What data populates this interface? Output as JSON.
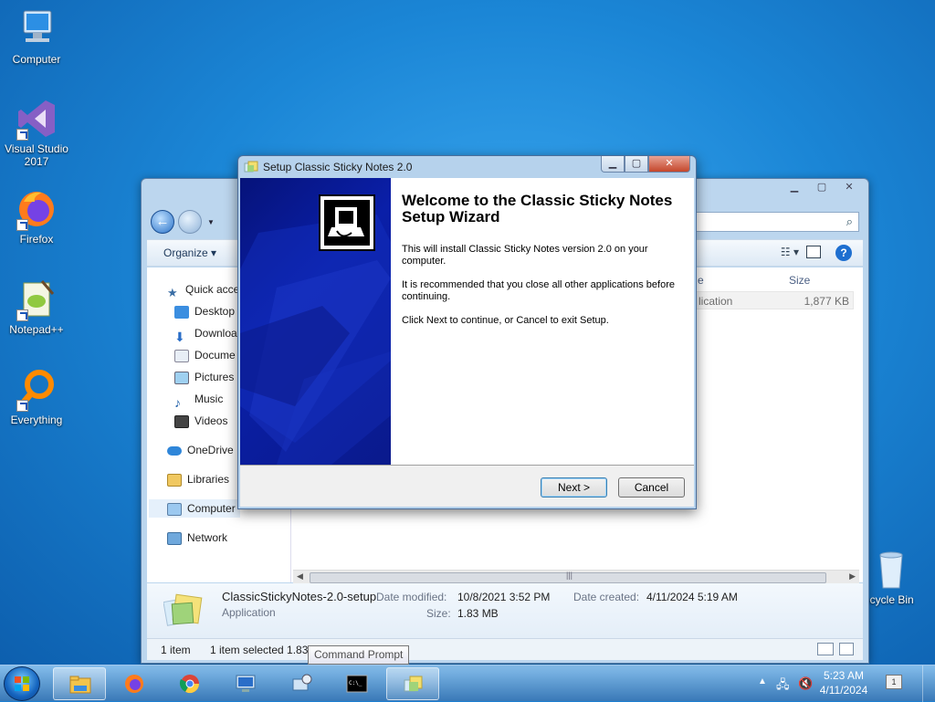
{
  "desktop_icons": [
    {
      "label": "Computer",
      "icon": "computer-icon"
    },
    {
      "label": "Visual Studio 2017",
      "icon": "visual-studio-icon"
    },
    {
      "label": "Firefox",
      "icon": "firefox-icon"
    },
    {
      "label": "Notepad++",
      "icon": "notepadpp-icon"
    },
    {
      "label": "Everything",
      "icon": "everything-icon"
    },
    {
      "label": "ecycle Bin",
      "icon": "recycle-bin-icon"
    }
  ],
  "explorer": {
    "toolbar": {
      "organize": "Organize ▾"
    },
    "nav": [
      {
        "label": "Quick acce",
        "icon": "star-icon"
      },
      {
        "label": "Desktop",
        "icon": "desktop-folder-icon"
      },
      {
        "label": "Downloa",
        "icon": "downloads-icon"
      },
      {
        "label": "Docume",
        "icon": "documents-icon"
      },
      {
        "label": "Pictures",
        "icon": "pictures-icon"
      },
      {
        "label": "Music",
        "icon": "music-icon"
      },
      {
        "label": "Videos",
        "icon": "videos-icon"
      },
      {
        "label": "OneDrive",
        "icon": "onedrive-icon"
      },
      {
        "label": "Libraries",
        "icon": "libraries-icon"
      },
      {
        "label": "Computer",
        "icon": "computer-icon"
      },
      {
        "label": "Network",
        "icon": "network-icon"
      }
    ],
    "columns": {
      "type": "e",
      "size": "Size"
    },
    "file_row": {
      "type": "lication",
      "size": "1,877 KB"
    },
    "details": {
      "name": "ClassicStickyNotes-2.0-setup",
      "kind": "Application",
      "date_modified_label": "Date modified:",
      "date_modified": "10/8/2021 3:52 PM",
      "size_label": "Size:",
      "size": "1.83 MB",
      "date_created_label": "Date created:",
      "date_created": "4/11/2024 5:19 AM"
    },
    "status": {
      "count": "1 item",
      "selected": "1 item selected  1.83 MB"
    }
  },
  "dialog": {
    "title": "Setup Classic Sticky Notes 2.0",
    "heading": "Welcome to the Classic Sticky Notes Setup Wizard",
    "para1": "This will install Classic Sticky Notes version 2.0 on your computer.",
    "para2": "It is recommended that you close all other applications before continuing.",
    "para3": "Click Next to continue, or Cancel to exit Setup.",
    "next": "Next >",
    "cancel": "Cancel"
  },
  "tooltip": "Command Prompt",
  "taskbar": {
    "items": [
      "file-explorer",
      "firefox",
      "chrome",
      "remote-desktop",
      "network-tool",
      "command-prompt",
      "setup"
    ],
    "time": "5:23 AM",
    "date": "4/11/2024",
    "notification_count": "1"
  }
}
